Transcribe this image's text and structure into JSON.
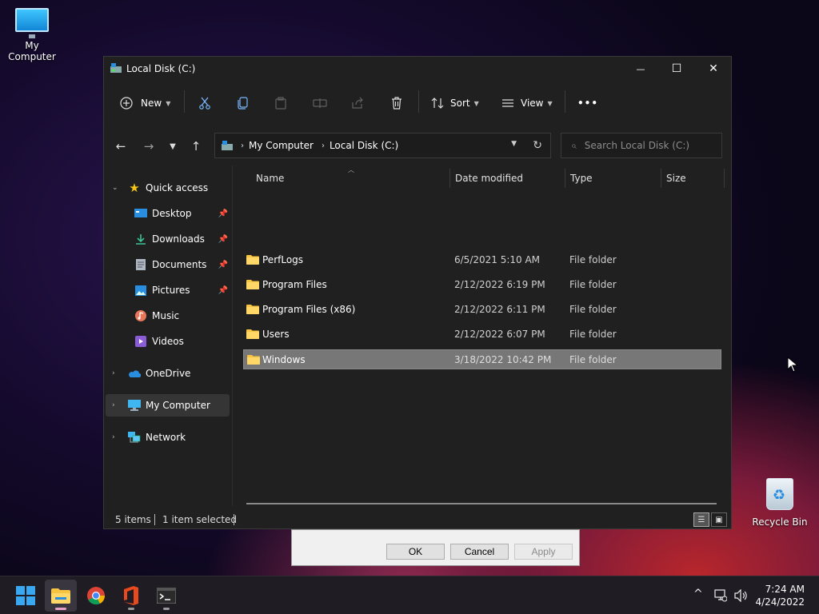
{
  "desktop": {
    "icons": [
      {
        "label": "My Computer"
      },
      {
        "label": "Recycle Bin"
      }
    ]
  },
  "window": {
    "title": "Local Disk (C:)",
    "controls": {
      "minimize": "—",
      "maximize": "☐",
      "close": "✕"
    }
  },
  "toolbar": {
    "new_label": "New",
    "sort_label": "Sort",
    "view_label": "View",
    "more_label": "•••"
  },
  "address": {
    "crumbs": [
      "My Computer",
      "Local Disk (C:)"
    ]
  },
  "search": {
    "placeholder": "Search Local Disk (C:)"
  },
  "sidebar": {
    "quick_access": "Quick access",
    "items": [
      {
        "label": "Desktop",
        "pinned": true
      },
      {
        "label": "Downloads",
        "pinned": true
      },
      {
        "label": "Documents",
        "pinned": true
      },
      {
        "label": "Pictures",
        "pinned": true
      },
      {
        "label": "Music",
        "pinned": false
      },
      {
        "label": "Videos",
        "pinned": false
      }
    ],
    "onedrive": "OneDrive",
    "my_computer": "My Computer",
    "network": "Network"
  },
  "columns": {
    "name": "Name",
    "date": "Date modified",
    "type": "Type",
    "size": "Size"
  },
  "files": [
    {
      "name": "PerfLogs",
      "date": "6/5/2021 5:10 AM",
      "type": "File folder"
    },
    {
      "name": "Program Files",
      "date": "2/12/2022 6:19 PM",
      "type": "File folder"
    },
    {
      "name": "Program Files (x86)",
      "date": "2/12/2022 6:11 PM",
      "type": "File folder"
    },
    {
      "name": "Users",
      "date": "2/12/2022 6:07 PM",
      "type": "File folder"
    },
    {
      "name": "Windows",
      "date": "3/18/2022 10:42 PM",
      "type": "File folder"
    }
  ],
  "status": {
    "count": "5 items",
    "selected": "1 item selected"
  },
  "dialog": {
    "ok": "OK",
    "cancel": "Cancel",
    "apply": "Apply"
  },
  "taskbar": {
    "time": "7:24 AM",
    "date": "4/24/2022",
    "tray_chevron": "^"
  },
  "colors": {
    "window_bg": "#202020",
    "selection": "#777777",
    "folder": "#f6c343",
    "accent": "#1a8fe0"
  }
}
